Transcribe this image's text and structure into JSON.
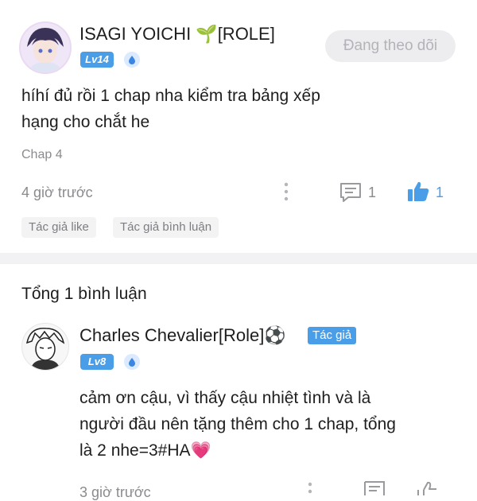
{
  "post": {
    "user_name": "ISAGI YOICHI 🌱[ROLE]",
    "level": "Lv14",
    "follow_label": "Đang theo dõi",
    "content_line1": "híhí đủ rồi 1 chap nha kiểm tra bảng xếp",
    "content_line2": "hạng cho chắt he",
    "chapter": "Chap 4",
    "time": "4 giờ trước",
    "comment_count": "1",
    "like_count": "1",
    "tag_author_like": "Tác giả like",
    "tag_author_comment": "Tác giả bình luận"
  },
  "comments_section": {
    "total_label": "Tổng 1 bình luận"
  },
  "reply": {
    "user_name": "Charles Chevalier[Role]⚽",
    "author_badge": "Tác giả",
    "level": "Lv8",
    "content_line1": "cảm ơn cậu, vì thấy cậu nhiệt tình và là",
    "content_line2": "người đầu nên tặng thêm cho 1 chap, tổng",
    "content_line3": "là 2 nhe=3#HA💗",
    "time": "3 giờ trước"
  },
  "colors": {
    "accent": "#4a9ee8",
    "muted_text": "#8b8b8f",
    "divider": "#f2f2f4"
  }
}
